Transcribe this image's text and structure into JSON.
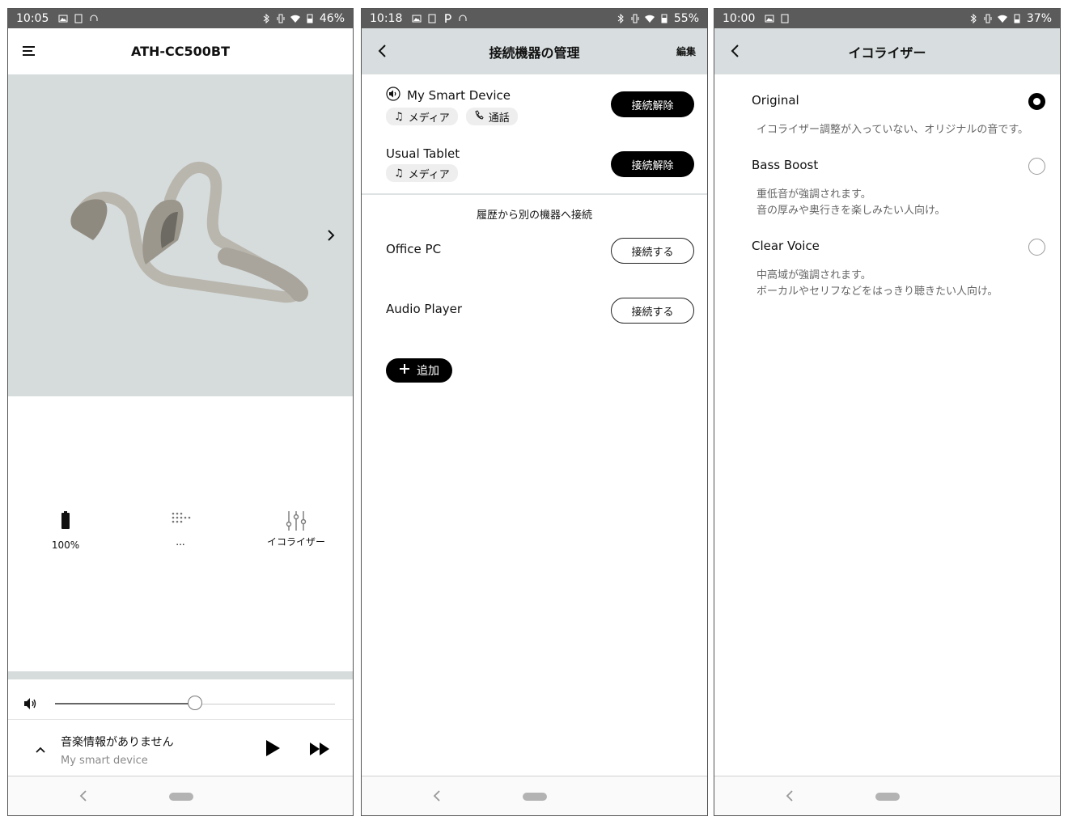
{
  "panel1": {
    "status": {
      "time": "10:05",
      "battery": "46%"
    },
    "title": "ATH-CC500BT",
    "stats": [
      {
        "label": "100%",
        "icon": "battery-icon"
      },
      {
        "label": "...",
        "icon": "dots-icon"
      },
      {
        "label": "イコライザー",
        "icon": "equalizer-icon"
      }
    ],
    "volume": {
      "level": 0.5
    },
    "player": {
      "title": "音楽情報がありません",
      "subtitle": "My smart device"
    }
  },
  "panel2": {
    "status": {
      "time": "10:18",
      "battery": "55%"
    },
    "title": "接続機器の管理",
    "edit_label": "編集",
    "connected": [
      {
        "name": "My Smart Device",
        "tags": [
          "メディア",
          "通話"
        ],
        "button": "接続解除"
      },
      {
        "name": "Usual Tablet",
        "tags": [
          "メディア"
        ],
        "button": "接続解除"
      }
    ],
    "history_title": "履歴から別の機器へ接続",
    "history": [
      {
        "name": "Office PC",
        "button": "接続する"
      },
      {
        "name": "Audio Player",
        "button": "接続する"
      }
    ],
    "add_label": "追加"
  },
  "panel3": {
    "status": {
      "time": "10:00",
      "battery": "37%"
    },
    "title": "イコライザー",
    "options": [
      {
        "name": "Original",
        "selected": true,
        "desc": [
          "イコライザー調整が入っていない、オリジナルの音です。"
        ]
      },
      {
        "name": "Bass Boost",
        "selected": false,
        "desc": [
          "重低音が強調されます。",
          "音の厚みや奥行きを楽しみたい人向け。"
        ]
      },
      {
        "name": "Clear Voice",
        "selected": false,
        "desc": [
          "中高域が強調されます。",
          "ボーカルやセリフなどをはっきり聴きたい人向け。"
        ]
      }
    ]
  }
}
